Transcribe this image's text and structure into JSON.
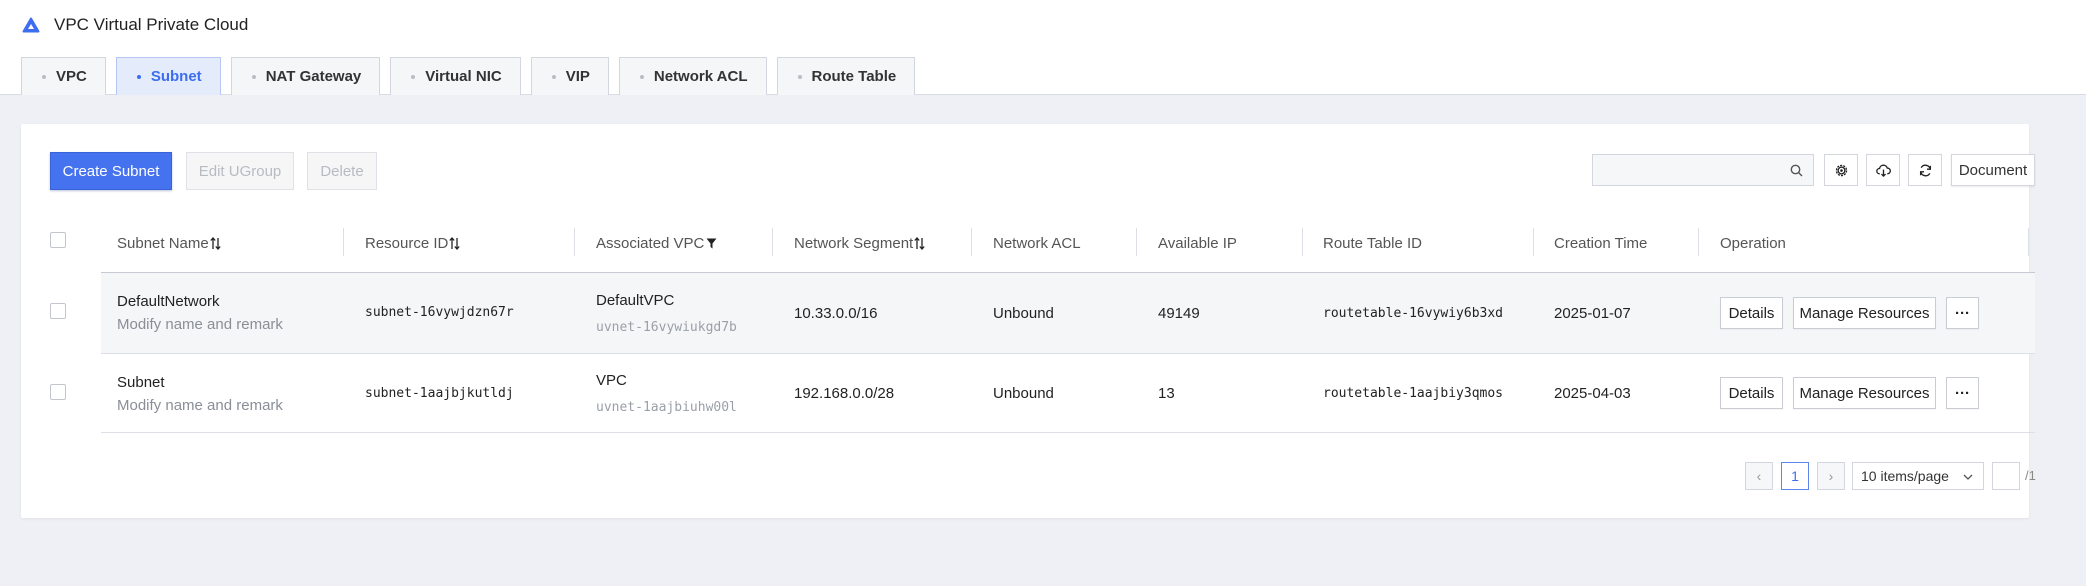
{
  "app": {
    "title": "VPC Virtual Private Cloud",
    "logo_icon": "cloud-logo-icon",
    "accent": "#4572ee"
  },
  "tabs": [
    {
      "label": "VPC",
      "active": false
    },
    {
      "label": "Subnet",
      "active": true
    },
    {
      "label": "NAT Gateway",
      "active": false
    },
    {
      "label": "Virtual NIC",
      "active": false
    },
    {
      "label": "VIP",
      "active": false
    },
    {
      "label": "Network ACL",
      "active": false
    },
    {
      "label": "Route Table",
      "active": false
    }
  ],
  "toolbar": {
    "create_label": "Create Subnet",
    "edit_label": "Edit UGroup",
    "delete_label": "Delete",
    "search_placeholder": "",
    "document_label": "Document",
    "icons": [
      "settings-icon",
      "download-cloud-icon",
      "refresh-icon",
      "search-icon"
    ]
  },
  "table": {
    "columns": [
      {
        "label": "Subnet Name",
        "sortable": true
      },
      {
        "label": "Resource ID",
        "sortable": true
      },
      {
        "label": "Associated VPC",
        "filter": true
      },
      {
        "label": "Network Segment",
        "sortable": true
      },
      {
        "label": "Network ACL"
      },
      {
        "label": "Available IP"
      },
      {
        "label": "Route Table ID"
      },
      {
        "label": "Creation Time"
      },
      {
        "label": "Operation"
      }
    ],
    "rows": [
      {
        "name": "DefaultNetwork",
        "remark": "Modify name and remark",
        "resource_id": "subnet-16vywjdzn67r",
        "vpc_name": "DefaultVPC",
        "vpc_id": "uvnet-16vywiukgd7b",
        "segment": "10.33.0.0/16",
        "acl": "Unbound",
        "available_ip": "49149",
        "route_table": "routetable-16vywiy6b3xd",
        "created": "2025-01-07",
        "details": "Details",
        "manage": "Manage Resources",
        "more": "···"
      },
      {
        "name": "Subnet",
        "remark": "Modify name and remark",
        "resource_id": "subnet-1aajbjkutldj",
        "vpc_name": "VPC",
        "vpc_id": "uvnet-1aajbiuhw00l",
        "segment": "192.168.0.0/28",
        "acl": "Unbound",
        "available_ip": "13",
        "route_table": "routetable-1aajbiy3qmos",
        "created": "2025-04-03",
        "details": "Details",
        "manage": "Manage Resources",
        "more": "···"
      }
    ]
  },
  "pagination": {
    "prev": "‹",
    "current": "1",
    "next": "›",
    "page_size": "10 items/page",
    "jump_value": "",
    "total": "/1"
  }
}
